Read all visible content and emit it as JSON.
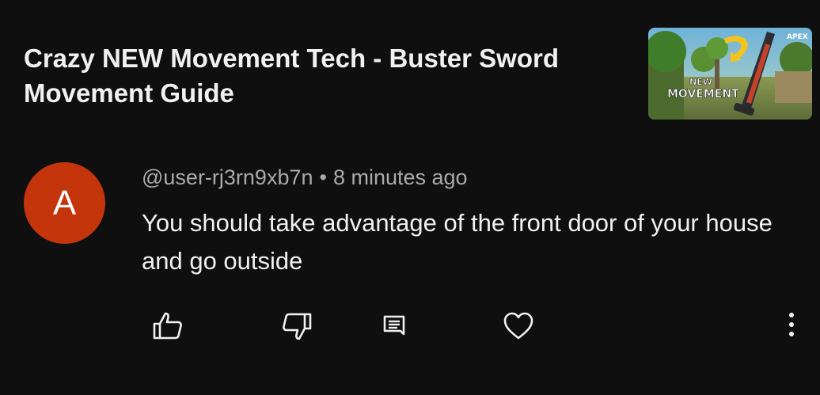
{
  "video": {
    "title": "Crazy NEW Movement Tech - Buster Sword Movement Guide",
    "thumbnail": {
      "overlay_line1": "NEW",
      "overlay_line2": "MOVEMENT",
      "corner_logo": "APEX"
    }
  },
  "comment": {
    "avatar_letter": "A",
    "avatar_color": "#c4350c",
    "author": "@user-rj3rn9xb7n",
    "separator": "•",
    "time": "8 minutes ago",
    "text": "You should take advantage of the front door of your house and go outside"
  },
  "actions": [
    {
      "name": "like",
      "icon": "thumbs-up-icon"
    },
    {
      "name": "dislike",
      "icon": "thumbs-down-icon"
    },
    {
      "name": "reply",
      "icon": "comment-icon"
    },
    {
      "name": "heart",
      "icon": "heart-icon"
    },
    {
      "name": "more",
      "icon": "more-vertical-icon"
    }
  ],
  "colors": {
    "background": "#0f0f0f",
    "primary_text": "#f1f1f1",
    "secondary_text": "#aaaaaa"
  }
}
